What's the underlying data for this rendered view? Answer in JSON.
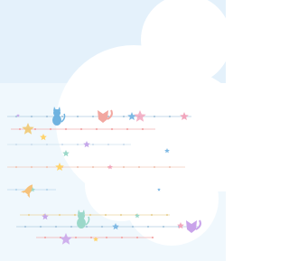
{
  "background": {
    "base_color": "#e4f1fb",
    "cloud_color": "#ffffff",
    "fade_color": "#f4f9fd"
  },
  "decorations": {
    "line_colors": [
      "#a9c8de",
      "#f3a8a8",
      "#cfe0ee",
      "#f1c7b7",
      "#b8d6ec",
      "#ead39a",
      "#a9c8de",
      "#f3a8a8"
    ],
    "star_colors": [
      "#7db8e4",
      "#f2a6bd",
      "#ffd36b",
      "#c5a7ea",
      "#9bd8c9"
    ],
    "charms": [
      "cat-charm",
      "fox-charm",
      "star-charm",
      "moon-charm",
      "rocket-charm",
      "cat-charm",
      "fox-charm",
      "moon-charm"
    ]
  }
}
